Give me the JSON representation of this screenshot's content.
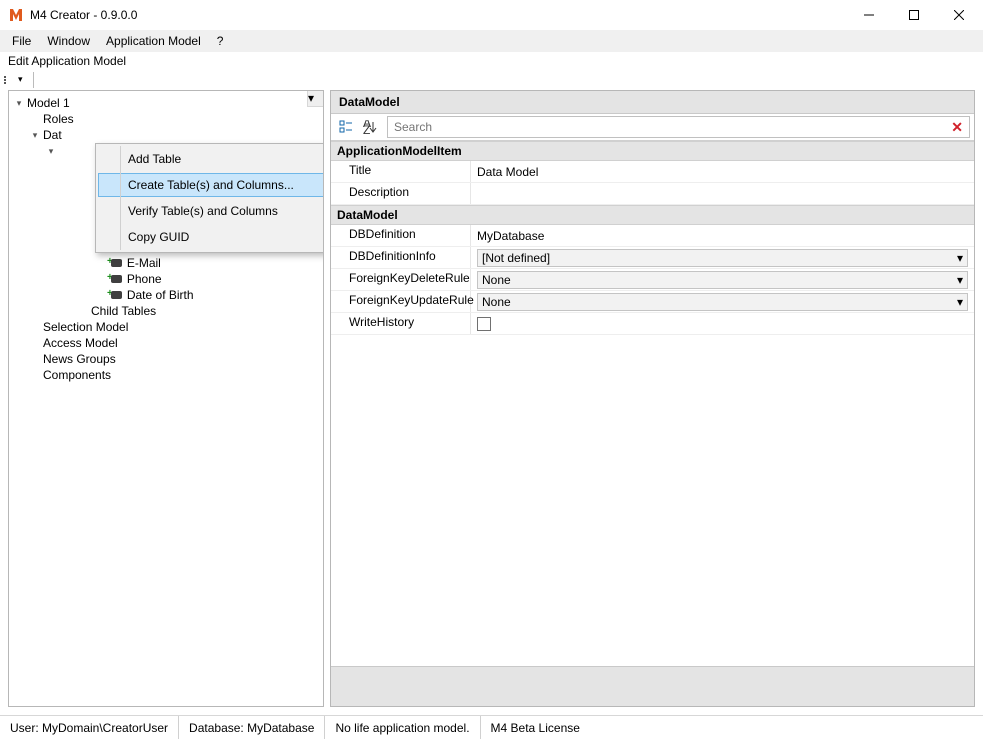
{
  "window": {
    "title": "M4 Creator - 0.9.0.0"
  },
  "menu": {
    "file": "File",
    "window": "Window",
    "appmodel": "Application Model",
    "help": "?"
  },
  "caption": "Edit Application Model",
  "tree": {
    "root": "Model 1",
    "nodes": {
      "roles": "Roles",
      "datamodels": "Dat",
      "email": "E-Mail",
      "phone": "Phone",
      "dob": "Date of Birth",
      "childtables": "Child Tables",
      "selmodel": "Selection Model",
      "accmodel": "Access Model",
      "newsgroups": "News Groups",
      "components": "Components"
    }
  },
  "context_menu": {
    "add_table": "Add Table",
    "create_tbl": "Create Table(s) and Columns...",
    "verify_tbl": "Verify Table(s) and Columns",
    "copy_guid": "Copy GUID"
  },
  "props": {
    "panel_title": "DataModel",
    "search_placeholder": "Search",
    "cat_item": "ApplicationModelItem",
    "title_lbl": "Title",
    "title_val": "Data Model",
    "desc_lbl": "Description",
    "desc_val": "",
    "cat_dm": "DataModel",
    "dbdef_lbl": "DBDefinition",
    "dbdef_val": "MyDatabase",
    "dbdefinfo_lbl": "DBDefinitionInfo",
    "dbdefinfo_val": "[Not defined]",
    "fkdel_lbl": "ForeignKeyDeleteRule",
    "fkdel_val": "None",
    "fkupd_lbl": "ForeignKeyUpdateRule",
    "fkupd_val": "None",
    "wh_lbl": "WriteHistory"
  },
  "status": {
    "user": "User: MyDomain\\CreatorUser",
    "db": "Database: MyDatabase",
    "app": "No life application model.",
    "license": "M4 Beta License"
  }
}
